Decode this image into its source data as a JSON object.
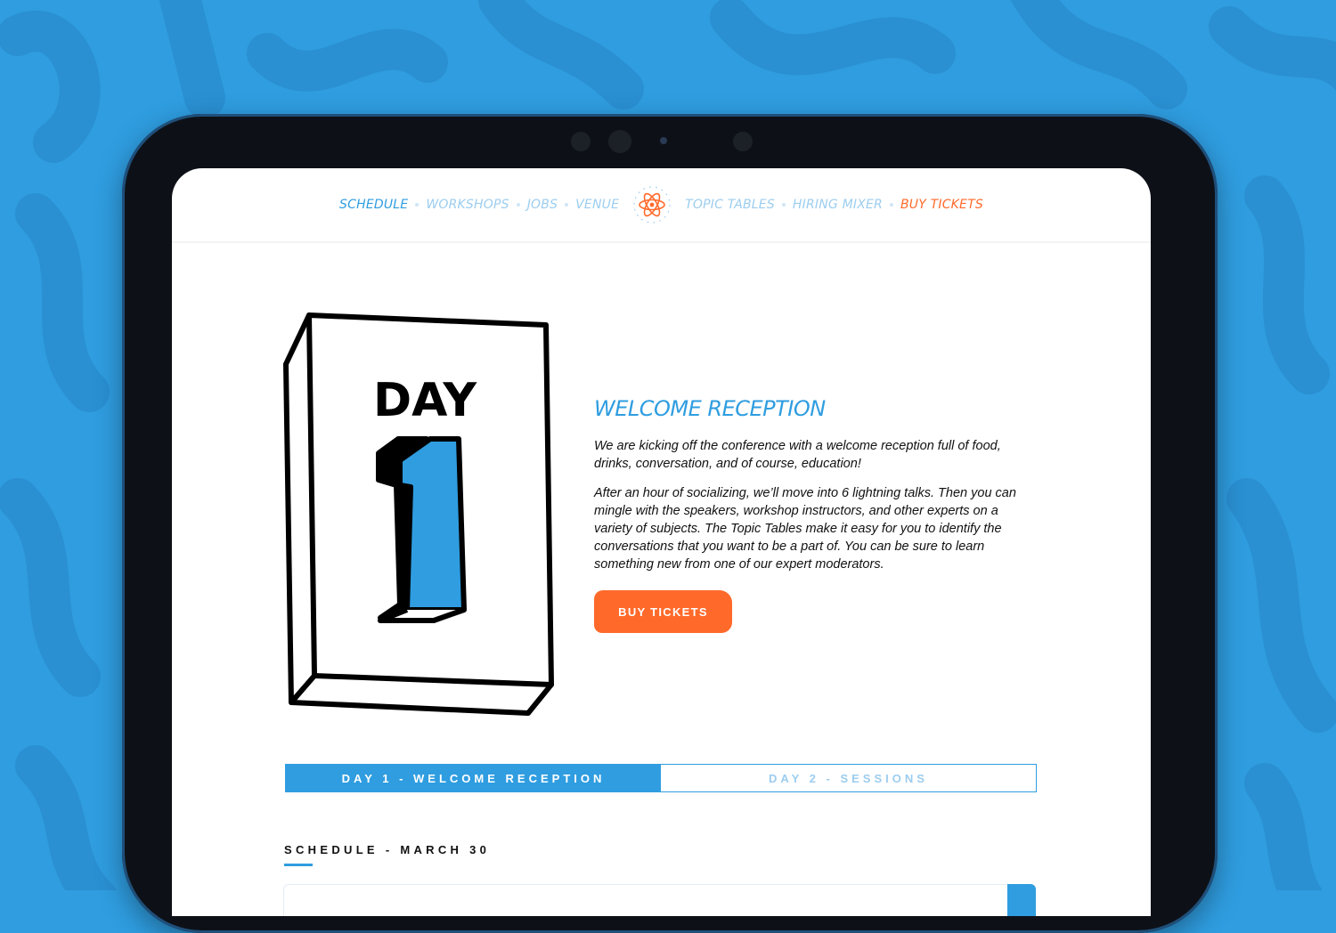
{
  "nav": {
    "left_links": [
      "Schedule",
      "Workshops",
      "Jobs",
      "Venue"
    ],
    "right_links": [
      "Topic Tables",
      "Hiring Mixer"
    ],
    "cta": "Buy Tickets",
    "logo_icon": "react-atom-logo-icon"
  },
  "hero": {
    "illustration_label": "DAY",
    "illustration_number": "1",
    "heading": "WELCOME RECEPTION",
    "paragraphs": [
      "We are kicking off the conference with a welcome reception full of food, drinks, conversation, and of course, education!",
      "After an hour of socializing, we’ll move into 6 lightning talks. Then you can mingle with the speakers, workshop instructors, and other experts on a variety of subjects. The Topic Tables make it easy for you to identify the conversations that you want to be a part of. You can be sure to learn something new from one of our expert moderators."
    ],
    "button": "BUY TICKETS"
  },
  "tabs": [
    {
      "label": "DAY 1 - WELCOME RECEPTION",
      "active": true
    },
    {
      "label": "DAY 2 - SESSIONS",
      "active": false
    }
  ],
  "schedule": {
    "title": "SCHEDULE - MARCH 30"
  },
  "colors": {
    "background": "#2f9de0",
    "accent": "#2f9de0",
    "cta": "#ff6a2b",
    "muted_link": "#9ccdef"
  }
}
